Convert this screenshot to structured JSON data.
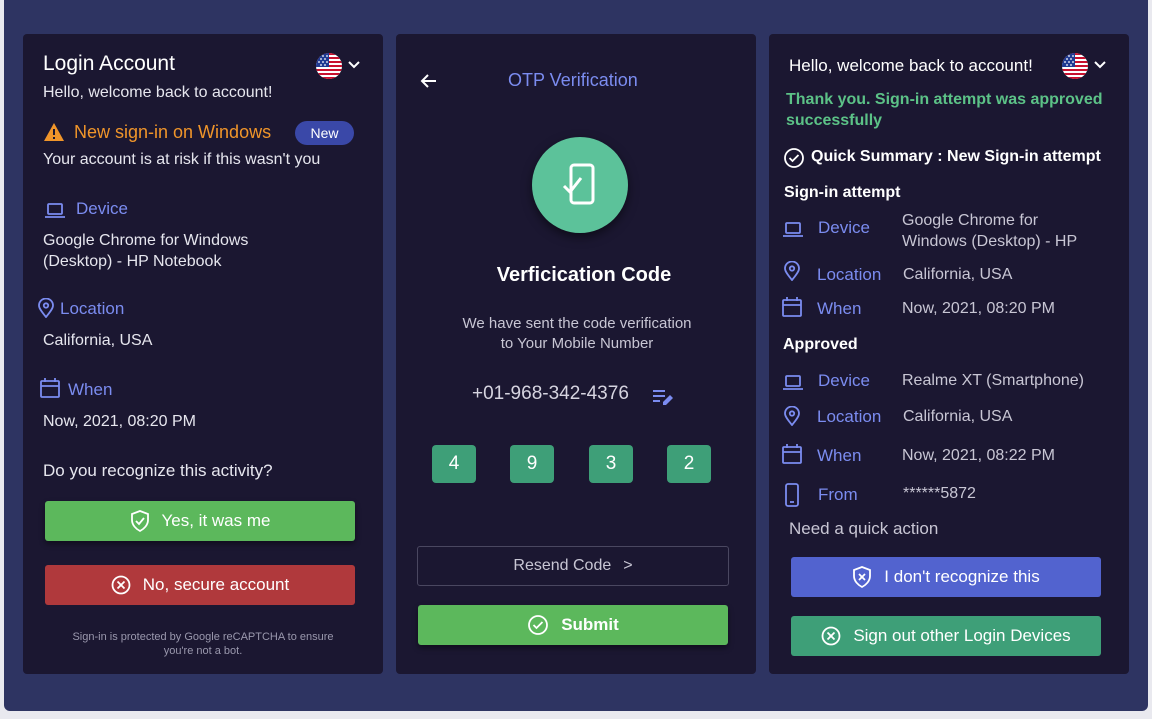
{
  "login": {
    "title": "Login Account",
    "subtitle": "Hello, welcome back to account!",
    "alert_title": "New sign-in on Windows",
    "alert_badge": "New",
    "alert_text": "Your account is at risk if this wasn't you",
    "device_label": "Device",
    "device_line1": "Google Chrome for Windows",
    "device_line2": "(Desktop) - HP Notebook",
    "location_label": "Location",
    "location_value": "California, USA",
    "when_label": "When",
    "when_value": "Now, 2021, 08:20 PM",
    "question": "Do you recognize this activity?",
    "yes_button": "Yes, it was me",
    "no_button": "No, secure account",
    "footer_line1": "Sign-in is protected by Google reCAPTCHA to ensure",
    "footer_line2": "you're not a bot."
  },
  "otp": {
    "header": "OTP Verification",
    "title": "Verficication Code",
    "message_line1": "We have sent the code verification",
    "message_line2": "to Your Mobile Number",
    "phone": "+01-968-342-4376",
    "digits": [
      "4",
      "9",
      "3",
      "2"
    ],
    "resend": "Resend Code",
    "resend_arrow": ">",
    "submit": "Submit"
  },
  "summary": {
    "greeting": "Hello, welcome back to account!",
    "success_line1": "Thank you. Sign-in attempt was approved",
    "success_line2": "successfully",
    "heading": "Quick Summary : New Sign-in attempt",
    "attempt_heading": "Sign-in attempt",
    "attempt": {
      "device_label": "Device",
      "device_line1": "Google Chrome for",
      "device_line2": "Windows (Desktop) - HP",
      "location_label": "Location",
      "location_value": "California, USA",
      "when_label": "When",
      "when_value": "Now, 2021, 08:20 PM"
    },
    "approved_heading": "Approved",
    "approved": {
      "device_label": "Device",
      "device_value": "Realme XT (Smartphone)",
      "location_label": "Location",
      "location_value": "California, USA",
      "when_label": "When",
      "when_value": "Now, 2021, 08:22 PM",
      "from_label": "From",
      "from_value": "******5872"
    },
    "quick_action": "Need a quick action",
    "dont_recognize": "I don't recognize this",
    "sign_out": "Sign out other Login Devices"
  },
  "colors": {
    "background": "#2e3462",
    "panel": "#1b1731",
    "accent_blue": "#7b8cf0",
    "success_green": "#5cc287",
    "warning_orange": "#f0952a",
    "button_green": "#5cb85c",
    "button_red": "#b0393c",
    "button_blue": "#5263cf",
    "button_teal": "#3e9f78"
  },
  "icons": [
    "us-flag-icon",
    "chevron-down-icon",
    "warning-icon",
    "laptop-icon",
    "location-pin-icon",
    "calendar-icon",
    "shield-check-icon",
    "close-circle-icon",
    "back-arrow-icon",
    "phone-check-icon",
    "edit-icon",
    "check-circle-icon",
    "smartphone-icon"
  ]
}
